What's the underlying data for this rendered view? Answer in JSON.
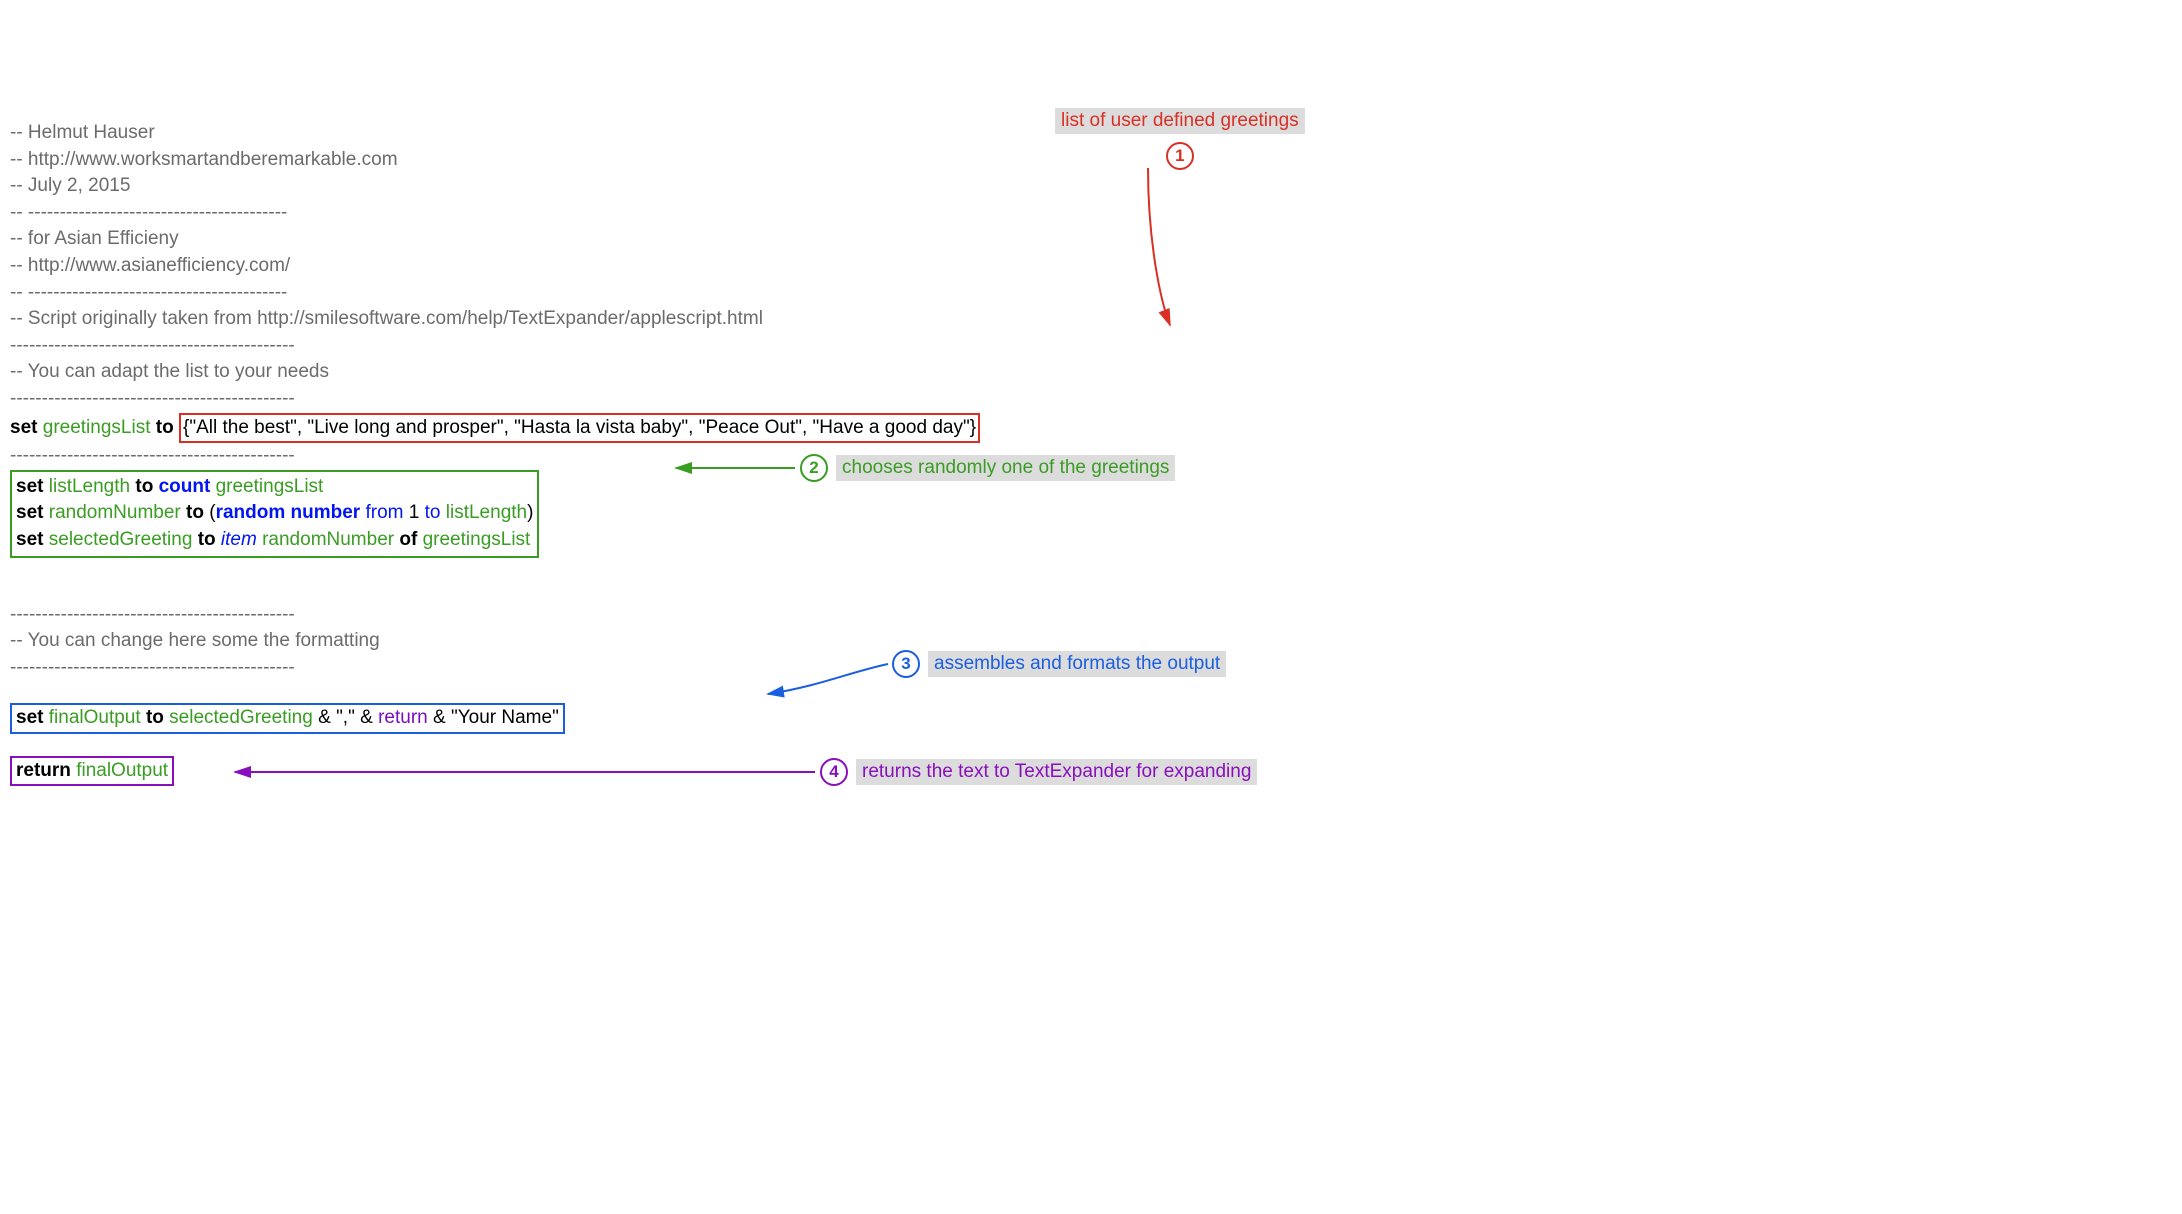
{
  "comments": {
    "author": "-- Helmut Hauser",
    "url1": "-- http://www.worksmartandberemarkable.com",
    "date": "-- July 2, 2015",
    "sep1": "-- -----------------------------------------",
    "for": "-- for Asian Efficieny",
    "url2": "-- http://www.asianefficiency.com/",
    "sep2": "-- -----------------------------------------",
    "origin": "-- Script originally taken from http://smilesoftware.com/help/TextExpander/applescript.html",
    "dash1": "---------------------------------------------",
    "adapt": "-- You can adapt the list to your needs",
    "dash2": "---------------------------------------------",
    "dash3": "---------------------------------------------",
    "dash4": "---------------------------------------------",
    "format": "-- You can change here some the formatting",
    "dash5": "---------------------------------------------"
  },
  "code": {
    "set": "set",
    "to": "to",
    "of": "of",
    "count": "count",
    "random": "random number",
    "from": "from",
    "toNum": "to",
    "item": "item",
    "return_kw": "return",
    "return_call": "return",
    "greetingsList": "greetingsList",
    "listLength": "listLength",
    "randomNumber": "randomNumber",
    "selectedGreeting": "selectedGreeting",
    "finalOutput": "finalOutput",
    "one": "1",
    "listLit": "{\"All the best\", \"Live long and prosper\", \"Hasta la vista baby\", \"Peace Out\", \"Have a good day\"}",
    "comma": "\",\"",
    "yourname": "\"Your Name\"",
    "amp": "&",
    "lparen": "(",
    "rparen": ")"
  },
  "annotations": {
    "n1": "1",
    "n2": "2",
    "n3": "3",
    "n4": "4",
    "t1": "list of user defined greetings",
    "t2": "chooses randomly one of the greetings",
    "t3": "assembles and formats the output",
    "t4": "returns the text to TextExpander for expanding"
  }
}
